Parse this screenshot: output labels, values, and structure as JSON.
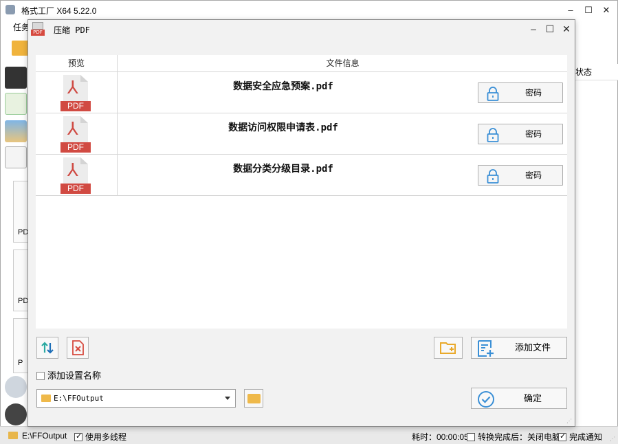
{
  "app": {
    "title": "格式工厂 X64 5.22.0",
    "menu_label": "任务",
    "right_column_header": "状态",
    "left_items": [
      {
        "label": "PD"
      },
      {
        "label": "PD"
      },
      {
        "label": "P"
      }
    ]
  },
  "dialog": {
    "title": "压缩 PDF",
    "table": {
      "col_preview": "预览",
      "col_info": "文件信息"
    },
    "files": [
      {
        "name": "数据安全应急预案.pdf",
        "thumb_label": "PDF",
        "password_label": "密码"
      },
      {
        "name": "数据访问权限申请表.pdf",
        "thumb_label": "PDF",
        "password_label": "密码"
      },
      {
        "name": "数据分类分级目录.pdf",
        "thumb_label": "PDF",
        "password_label": "密码"
      }
    ],
    "add_file_label": "添加文件",
    "add_setting_name_label": "添加设置名称",
    "output_path": "E:\\FFOutput",
    "confirm_label": "确定"
  },
  "statusbar": {
    "output_path": "E:\\FFOutput",
    "multithread_label": "使用多线程",
    "elapsed_label": "耗时：00:00:05",
    "after_convert_label": "转换完成后：关闭电脑",
    "notify_label": "完成通知"
  },
  "colors": {
    "pdf_red": "#d14a42",
    "accent_blue": "#3a8fd6",
    "folder_yellow": "#efb94a"
  }
}
